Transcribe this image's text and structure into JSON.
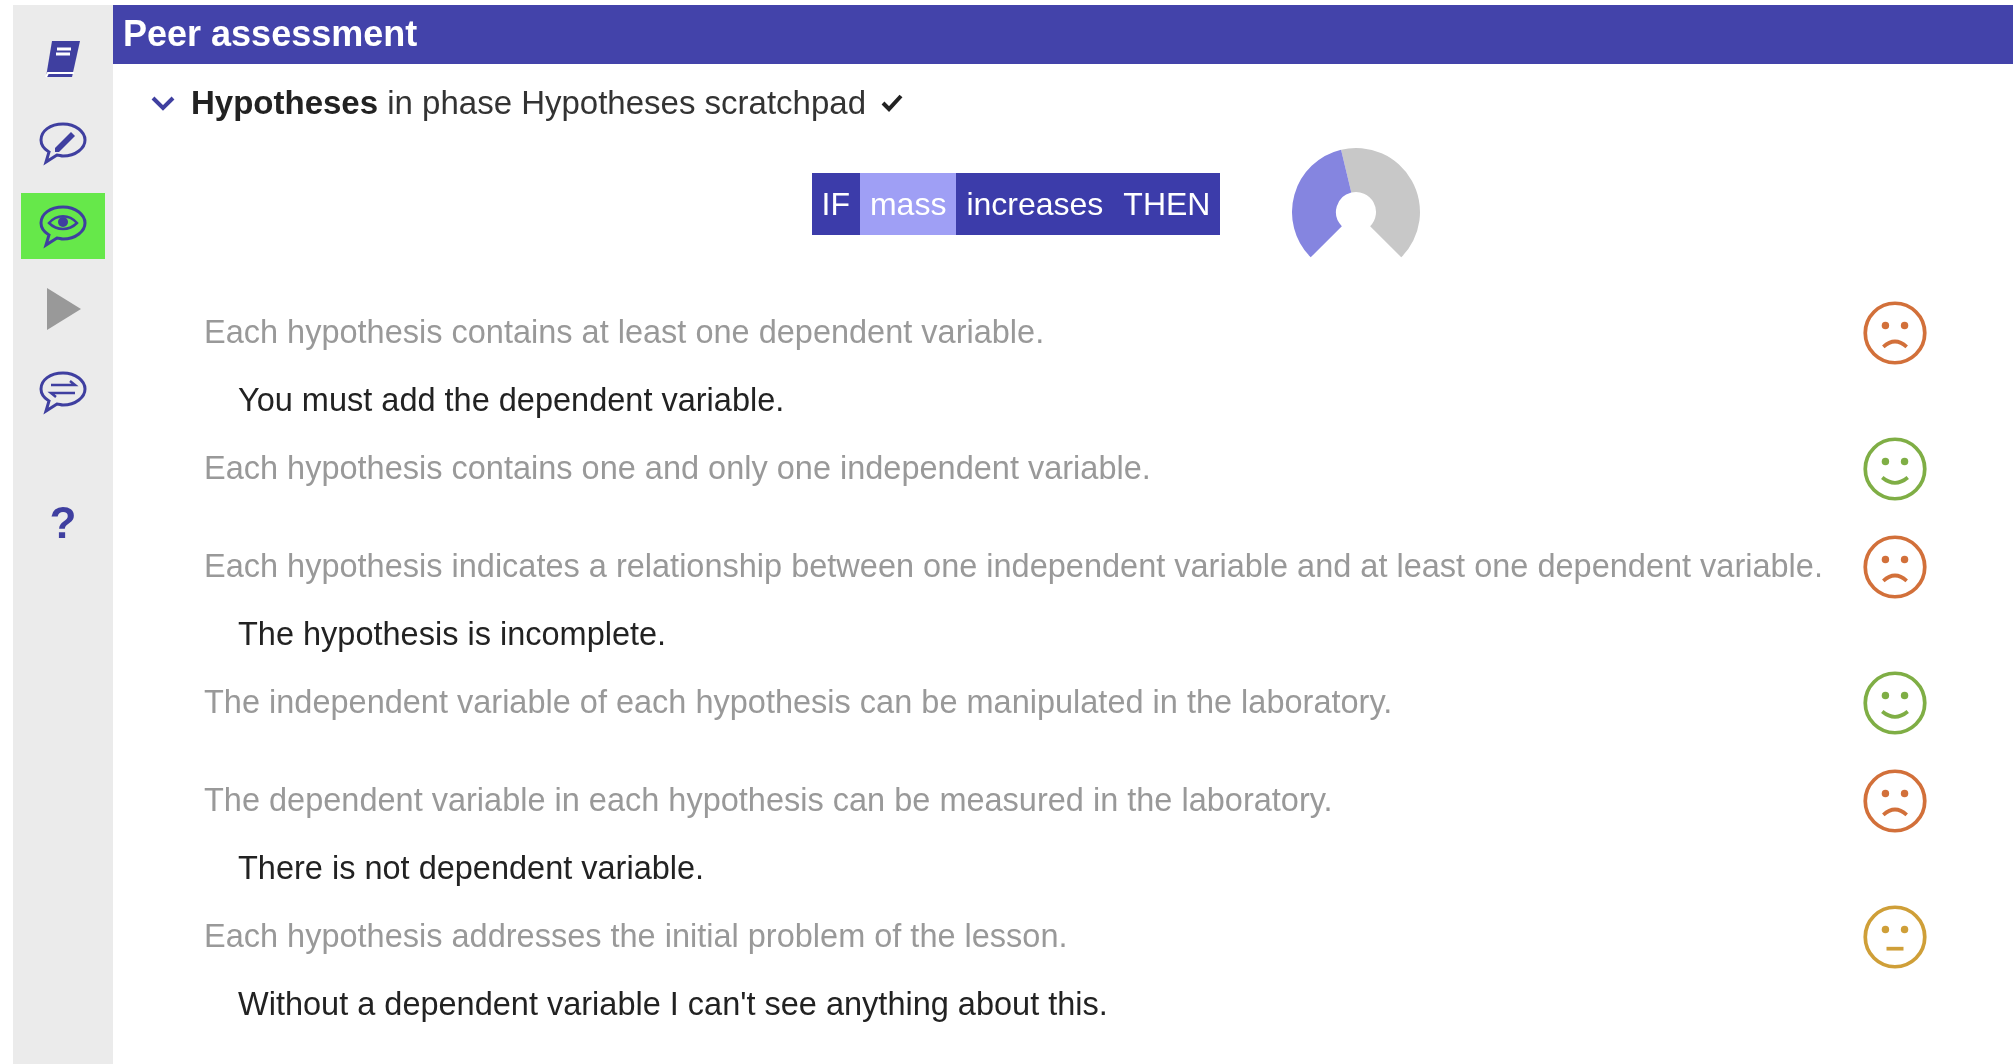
{
  "sidebar": {
    "items": [
      {
        "selected": false
      },
      {
        "selected": false
      },
      {
        "selected": true
      },
      {
        "selected": false
      },
      {
        "selected": false
      },
      {
        "label": "?",
        "selected": false
      }
    ]
  },
  "header": {
    "title": "Peer assessment"
  },
  "section": {
    "expanded": true,
    "name": "Hypotheses",
    "phase_text": "in phase Hypotheses scratchpad",
    "done": true
  },
  "hypothesis": {
    "parts": [
      {
        "text": "IF",
        "kind": "keyword"
      },
      {
        "text": "mass",
        "kind": "variable"
      },
      {
        "text": "increases",
        "kind": "keyword"
      },
      {
        "text": "THEN",
        "kind": "keyword"
      }
    ]
  },
  "criteria": [
    {
      "text": "Each hypothesis contains at least one dependent variable.",
      "comment": "You must add the dependent variable.",
      "kind": "sad"
    },
    {
      "text": "Each hypothesis contains one and only one independent variable.",
      "kind": "happy"
    },
    {
      "text": "Each hypothesis indicates a relationship between one independent variable and at least one dependent variable.",
      "comment": "The hypothesis is incomplete.",
      "kind": "sad"
    },
    {
      "text": "The independent variable of each hypothesis can be manipulated in the laboratory.",
      "kind": "happy"
    },
    {
      "text": "The dependent variable in each hypothesis can be measured in the laboratory.",
      "comment": "There is not dependent variable.",
      "kind": "sad"
    },
    {
      "text": "Each hypothesis addresses the initial problem of the lesson.",
      "comment": "Without a dependent variable I can't see anything about this.",
      "kind": "neutral"
    }
  ]
}
